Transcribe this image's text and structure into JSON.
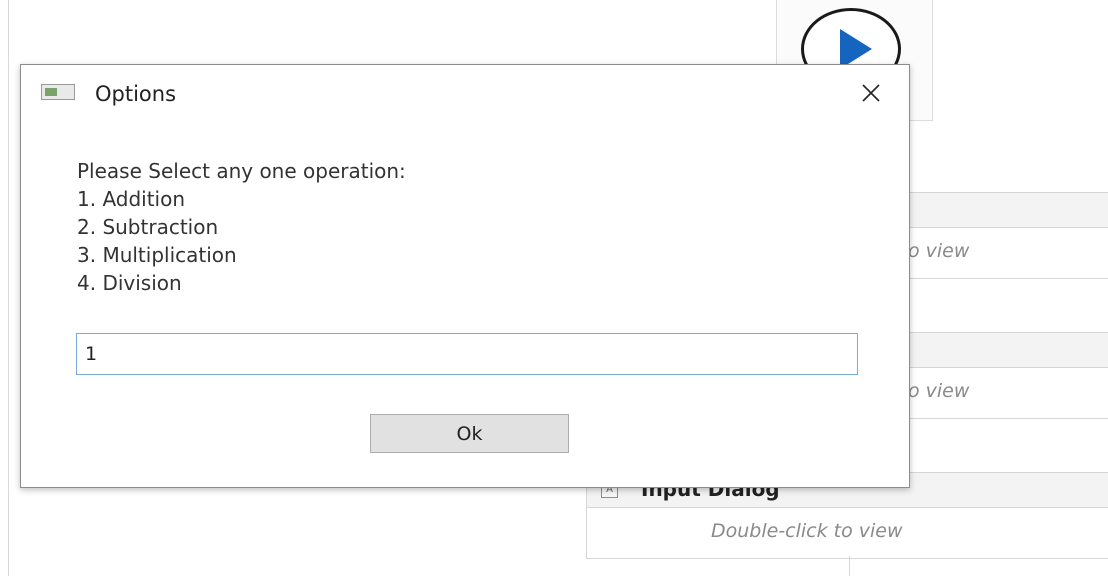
{
  "dialog": {
    "title": "Options",
    "prompt_heading": "Please Select any one operation:",
    "options": [
      "1. Addition",
      "2. Subtraction",
      "3. Multiplication",
      "4. Division"
    ],
    "input_value": "1",
    "ok_label": "Ok",
    "close_icon": "close-icon",
    "window_icon": "window-icon"
  },
  "background": {
    "play_icon": "play-icon",
    "play_color": "#1565c0",
    "activities": [
      {
        "hint": "o view"
      },
      {
        "hint": "o view"
      },
      {
        "title": "Input Dialog",
        "hint": "Double-click to view",
        "icon": "input-dialog-icon"
      }
    ]
  }
}
